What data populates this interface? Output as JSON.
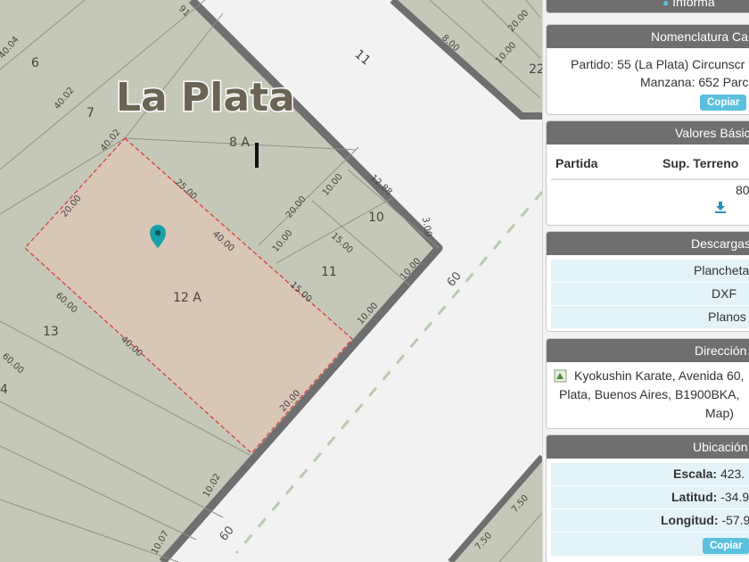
{
  "map": {
    "city_label": "La Plata",
    "lots": {
      "l6": "6",
      "l7": "7",
      "l8a": "8 A",
      "l10": "10",
      "l11": "11",
      "l12a": "12 A",
      "l13": "13",
      "l4": "4",
      "l22": "22",
      "block11": "11"
    },
    "dims": {
      "d4004": "40.04",
      "d4002a": "40.02",
      "d4002b": "40.02",
      "d91": "91",
      "d2000a": "20.00",
      "d2500": "25.00",
      "d4000a": "40.00",
      "d1500a": "15.00",
      "d6000a": "60.00",
      "d4000b": "40.00",
      "d2000b": "20.00",
      "d6000b": "60.00",
      "d1000a": "10.00",
      "d2000c": "20.00",
      "d1000b": "10.00",
      "d1500b": "15.00",
      "d1288": "12.88",
      "d300": "3.00",
      "d1000c": "10.00",
      "d1000d": "10.00",
      "d1002": "10.02",
      "d1007": "10.07",
      "d800": "8.00",
      "d1000e": "10.00",
      "d2000d": "20.00",
      "d750a": "7.50",
      "d750b": "7.50"
    },
    "streets": {
      "s60a": "60",
      "s60b": "60"
    }
  },
  "panel": {
    "top_partial_label": "Informa",
    "nomenclatura": {
      "title": "Nomenclatura Ca",
      "line1": "Partido: 55 (La Plata) Circunscr",
      "line2": "Manzana: 652 Parc",
      "copy_label": "Copiar"
    },
    "valores": {
      "title": "Valores Básic",
      "col_partida": "Partida",
      "col_sup": "Sup. Terreno",
      "sup_value": "80"
    },
    "descargas": {
      "title": "Descargas",
      "items": [
        "Plancheta",
        "DXF",
        "Planos"
      ]
    },
    "direccion": {
      "title": "Dirección",
      "line1": "Kyokushin Karate, Avenida 60,",
      "line2": "Plata, Buenos Aires, B1900BKA,",
      "line3": "Map)"
    },
    "ubicacion": {
      "title": "Ubicación",
      "escala_label": "Escala:",
      "escala_value": "423.",
      "latitud_label": "Latitud:",
      "latitud_value": "-34.9",
      "longitud_label": "Longitud:",
      "longitud_value": "-57.9",
      "copy_label": "Copiar"
    }
  },
  "colors": {
    "parcel": "#c5c8b8",
    "street": "#f2f2f2",
    "block_edge": "#6f6f6f",
    "selected_fill": "#d8c6b6",
    "selected_stroke": "#d9362f",
    "marker": "#1aa0a8",
    "panel_header": "#6f6f6f",
    "copy_button": "#5bc0de"
  }
}
